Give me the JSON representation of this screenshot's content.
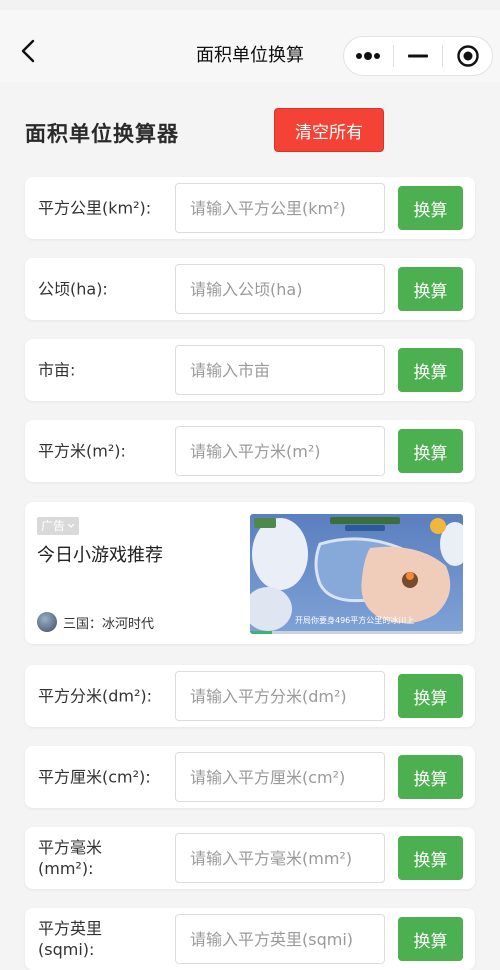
{
  "nav": {
    "title": "面积单位换算"
  },
  "header": {
    "title": "面积单位换算器",
    "clear_label": "清空所有"
  },
  "units": [
    {
      "label": "平方公里(km²):",
      "placeholder": "请输入平方公里(km²)",
      "button": "换算"
    },
    {
      "label": "公顷(ha):",
      "placeholder": "请输入公顷(ha)",
      "button": "换算"
    },
    {
      "label": "市亩:",
      "placeholder": "请输入市亩",
      "button": "换算"
    },
    {
      "label": "平方米(m²):",
      "placeholder": "请输入平方米(m²)",
      "button": "换算"
    },
    {
      "label": "平方分米(dm²):",
      "placeholder": "请输入平方分米(dm²)",
      "button": "换算"
    },
    {
      "label": "平方厘米(cm²):",
      "placeholder": "请输入平方厘米(cm²)",
      "button": "换算"
    },
    {
      "label": "平方毫米(mm²):",
      "placeholder": "请输入平方毫米(mm²)",
      "button": "换算"
    },
    {
      "label": "平方英里(sqmi):",
      "placeholder": "请输入平方英里(sqmi)",
      "button": "换算"
    }
  ],
  "ad": {
    "badge": "广告",
    "title": "今日小游戏推荐",
    "source": "三国：冰河时代",
    "caption": "开局你要身496平方公里的冰川上"
  },
  "icons": {
    "back": "chevron-left-icon",
    "more": "more-dots-icon",
    "minimize": "minus-icon",
    "close": "target-icon",
    "badge_arrow": "chevron-down-icon"
  },
  "colors": {
    "clear_button": "#f44336",
    "convert_button": "#4caf50"
  }
}
